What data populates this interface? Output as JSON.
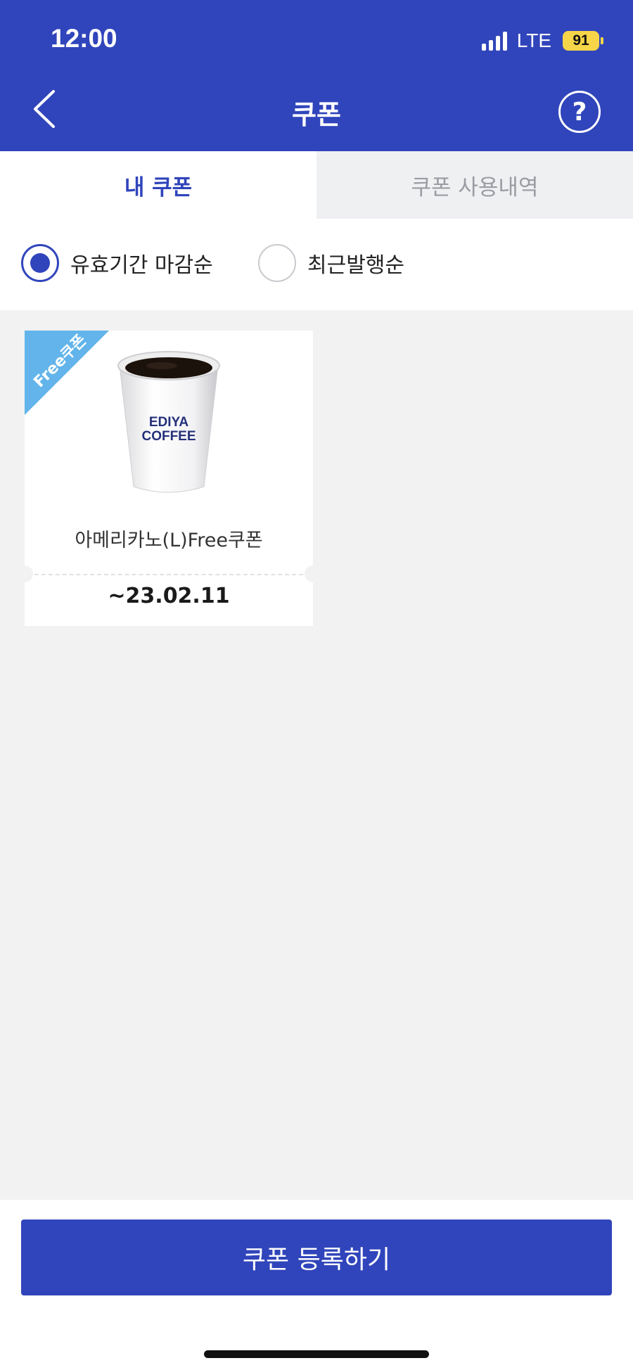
{
  "status_bar": {
    "time": "12:00",
    "network": "LTE",
    "battery": "91"
  },
  "header": {
    "title": "쿠폰",
    "help_label": "?"
  },
  "tabs": [
    {
      "label": "내 쿠폰",
      "active": true
    },
    {
      "label": "쿠폰 사용내역",
      "active": false
    }
  ],
  "sort": {
    "options": [
      {
        "label": "유효기간 마감순",
        "selected": true
      },
      {
        "label": "최근발행순",
        "selected": false
      }
    ]
  },
  "coupons": [
    {
      "badge": "Free쿠폰",
      "brand": [
        "EDIYA",
        "COFFEE"
      ],
      "name": "아메리카노(L)Free쿠폰",
      "expiry": "~23.02.11"
    }
  ],
  "footer": {
    "register_label": "쿠폰 등록하기"
  },
  "colors": {
    "primary": "#3045bb",
    "badge": "#62b4ea",
    "battery": "#f7d548",
    "background": "#f2f2f3"
  }
}
